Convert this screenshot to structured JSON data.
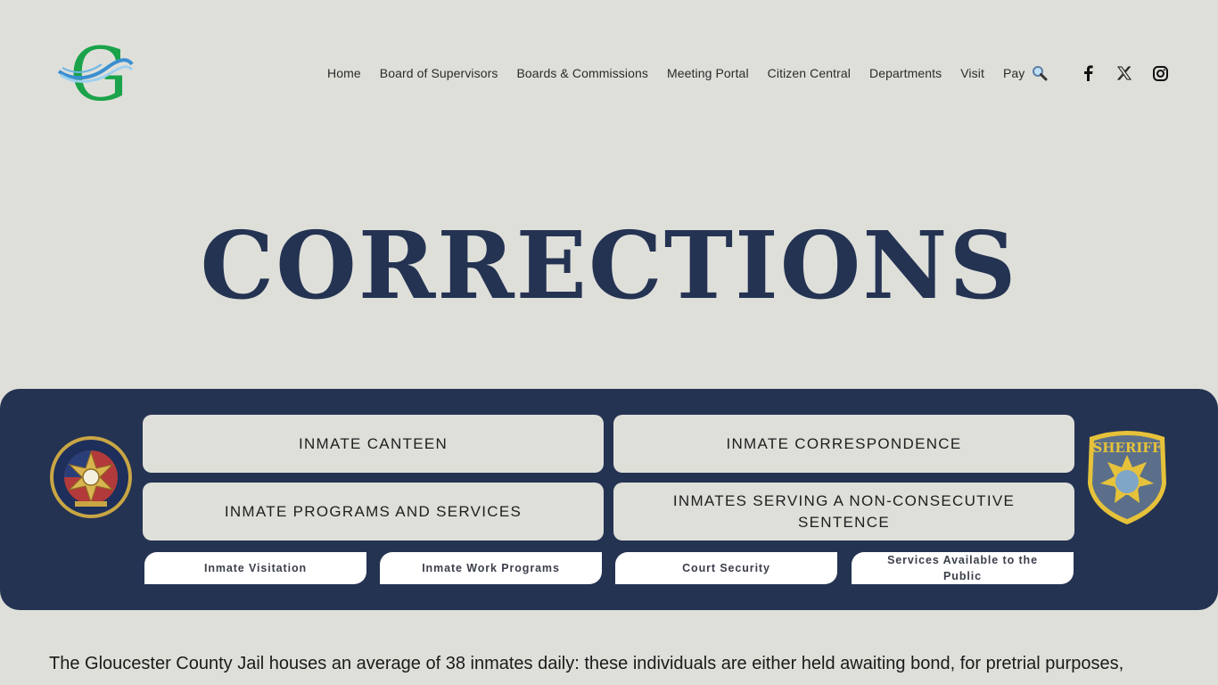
{
  "header": {
    "logo_alt": "Gloucester County G logo",
    "nav": [
      {
        "label": "Home"
      },
      {
        "label": "Board of Supervisors"
      },
      {
        "label": "Boards & Commissions"
      },
      {
        "label": "Meeting Portal"
      },
      {
        "label": "Citizen Central"
      },
      {
        "label": "Departments"
      },
      {
        "label": "Visit"
      },
      {
        "label": "Pay"
      }
    ],
    "icons": {
      "search": "search-icon",
      "facebook": "facebook-icon",
      "x": "x-icon",
      "instagram": "instagram-icon"
    }
  },
  "page": {
    "title": "CORRECTIONS"
  },
  "band": {
    "left_seal": "Gloucester County Sheriff's Office Est. 1651",
    "right_seal": "Sheriff Gloucester County Virginia Est. 1651",
    "primary_buttons": [
      {
        "label": "INMATE CANTEEN"
      },
      {
        "label": "INMATE CORRESPONDENCE"
      },
      {
        "label": "INMATE PROGRAMS AND SERVICES"
      },
      {
        "label": "INMATES SERVING A NON-CONSECUTIVE SENTENCE"
      }
    ],
    "secondary_buttons": [
      {
        "label": "Inmate Visitation"
      },
      {
        "label": "Inmate Work Programs"
      },
      {
        "label": "Court Security"
      },
      {
        "label": "Services Available to the Public"
      }
    ]
  },
  "content": {
    "intro": "The Gloucester County Jail houses an average of 38 inmates daily: these individuals are either held awaiting bond, for pretrial purposes,"
  },
  "colors": {
    "background": "#dfdfda",
    "navy": "#243352",
    "logo_green": "#1aa34a",
    "logo_blue": "#3a8fd0"
  }
}
